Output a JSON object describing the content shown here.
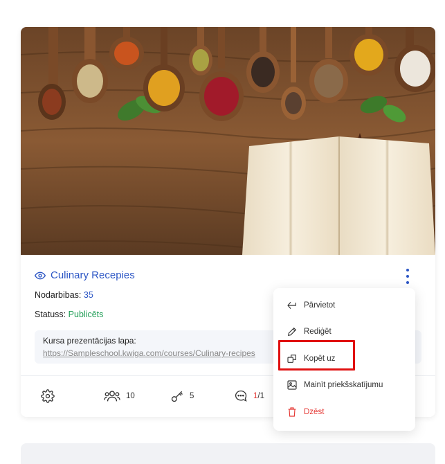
{
  "course": {
    "title": "Culinary Recepies",
    "lessons_label": "Nodarbibas:",
    "lessons_count": "35",
    "status_label": "Statuss:",
    "status_value": "Publicēts",
    "presentation_label": "Kursa prezentācijas lapa:",
    "presentation_url": "https://Sampleschool.kwiga.com/courses/Culinary-recipes"
  },
  "stats": {
    "students": "10",
    "keys": "5",
    "comments_new": "1",
    "comments_total": "/1"
  },
  "menu": {
    "move": "Pārvietot",
    "edit": "Rediģēt",
    "copy_to": "Kopēt uz",
    "change_preview": "Mainīt priekšskatījumu",
    "delete": "Dzēst"
  },
  "colors": {
    "accent": "#2c56c5",
    "status_green": "#1f9d55",
    "danger": "#e53935",
    "highlight": "#e01010"
  }
}
